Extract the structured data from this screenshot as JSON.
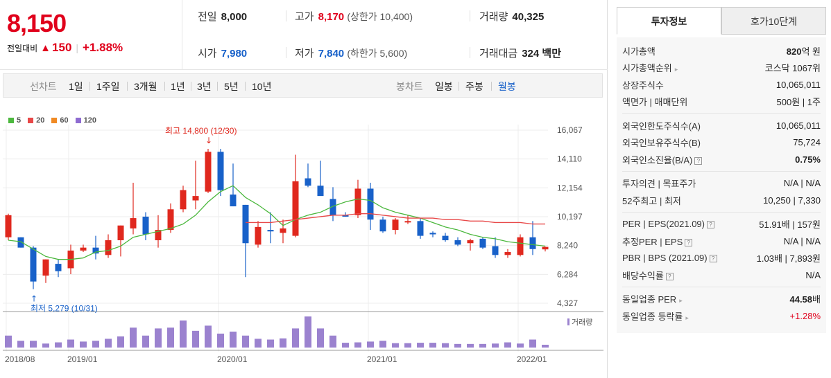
{
  "price": {
    "current": "8,150",
    "change_label": "전일대비",
    "change_amount": "150",
    "change_percent": "+1.88%"
  },
  "summary": {
    "prev_close": {
      "label": "전일",
      "value": "8,000"
    },
    "high": {
      "label": "고가",
      "value": "8,170",
      "sub": "(상한가 10,400)"
    },
    "volume": {
      "label": "거래량",
      "value": "40,325"
    },
    "open": {
      "label": "시가",
      "value": "7,980"
    },
    "low": {
      "label": "저가",
      "value": "7,840",
      "sub": "(하한가 5,600)"
    },
    "amount": {
      "label": "거래대금",
      "value": "324 백만"
    }
  },
  "period_bar": {
    "line_label": "선차트",
    "line_options": [
      "1일",
      "1주일",
      "3개월",
      "1년",
      "3년",
      "5년",
      "10년"
    ],
    "candle_label": "봉차트",
    "candle_options": [
      "일봉",
      "주봉",
      "월봉"
    ],
    "candle_selected": "월봉"
  },
  "chart_data": {
    "type": "candlestick",
    "interval": "monthly",
    "moving_averages": [
      {
        "name": "5",
        "color": "#4cb83e"
      },
      {
        "name": "20",
        "color": "#e84848"
      },
      {
        "name": "60",
        "color": "#f08a24"
      },
      {
        "name": "120",
        "color": "#8e6bd1"
      }
    ],
    "y_ticks": [
      "16,067",
      "14,110",
      "12,154",
      "10,197",
      "8,240",
      "6,284",
      "4,327"
    ],
    "y_range": [
      4327,
      16067
    ],
    "x_ticks": [
      "2018/08",
      "2019/01",
      "2020/01",
      "2021/01",
      "2022/01"
    ],
    "high_annotation": "최고 14,800 (12/30)",
    "low_annotation": "최저 5,279 (10/31)",
    "volume_label": "거래량",
    "candles": [
      {
        "m": "2018/08",
        "o": 8800,
        "h": 10400,
        "l": 8600,
        "c": 10300
      },
      {
        "m": "2018/09",
        "o": 8800,
        "h": 8800,
        "l": 8100,
        "c": 8100
      },
      {
        "m": "2018/10",
        "o": 8100,
        "h": 8200,
        "l": 5279,
        "c": 5800
      },
      {
        "m": "2018/11",
        "o": 6200,
        "h": 7300,
        "l": 5700,
        "c": 7300
      },
      {
        "m": "2018/12",
        "o": 7000,
        "h": 7300,
        "l": 6100,
        "c": 6500
      },
      {
        "m": "2019/01",
        "o": 6700,
        "h": 8300,
        "l": 6300,
        "c": 7900
      },
      {
        "m": "2019/02",
        "o": 7900,
        "h": 8300,
        "l": 7800,
        "c": 8100
      },
      {
        "m": "2019/03",
        "o": 8100,
        "h": 8900,
        "l": 7300,
        "c": 7700
      },
      {
        "m": "2019/04",
        "o": 7600,
        "h": 9000,
        "l": 7400,
        "c": 8600
      },
      {
        "m": "2019/05",
        "o": 8600,
        "h": 9600,
        "l": 7500,
        "c": 9600
      },
      {
        "m": "2019/06",
        "o": 9400,
        "h": 12500,
        "l": 9000,
        "c": 10100
      },
      {
        "m": "2019/07",
        "o": 10200,
        "h": 10500,
        "l": 8600,
        "c": 9000
      },
      {
        "m": "2019/08",
        "o": 8600,
        "h": 10300,
        "l": 8100,
        "c": 9300
      },
      {
        "m": "2019/09",
        "o": 9300,
        "h": 11100,
        "l": 9100,
        "c": 10700
      },
      {
        "m": "2019/10",
        "o": 10700,
        "h": 12300,
        "l": 10500,
        "c": 12000
      },
      {
        "m": "2019/11",
        "o": 11300,
        "h": 14000,
        "l": 10700,
        "c": 11600
      },
      {
        "m": "2019/12",
        "o": 11900,
        "h": 14800,
        "l": 11800,
        "c": 14600
      },
      {
        "m": "2020/01",
        "o": 14600,
        "h": 14800,
        "l": 11600,
        "c": 12000
      },
      {
        "m": "2020/02",
        "o": 11700,
        "h": 13800,
        "l": 10900,
        "c": 10900
      },
      {
        "m": "2020/03",
        "o": 11000,
        "h": 11000,
        "l": 6100,
        "c": 8400
      },
      {
        "m": "2020/04",
        "o": 8300,
        "h": 9900,
        "l": 8100,
        "c": 9500
      },
      {
        "m": "2020/05",
        "o": 9300,
        "h": 10500,
        "l": 8400,
        "c": 9200
      },
      {
        "m": "2020/06",
        "o": 9100,
        "h": 10000,
        "l": 8400,
        "c": 9400
      },
      {
        "m": "2020/07",
        "o": 8900,
        "h": 14400,
        "l": 8800,
        "c": 12600
      },
      {
        "m": "2020/08",
        "o": 12800,
        "h": 13800,
        "l": 12200,
        "c": 12300
      },
      {
        "m": "2020/09",
        "o": 12300,
        "h": 14000,
        "l": 11800,
        "c": 11600
      },
      {
        "m": "2020/10",
        "o": 11400,
        "h": 12200,
        "l": 9900,
        "c": 10300
      },
      {
        "m": "2020/11",
        "o": 10300,
        "h": 10500,
        "l": 10200,
        "c": 10200
      },
      {
        "m": "2020/12",
        "o": 10300,
        "h": 12700,
        "l": 10100,
        "c": 12100
      },
      {
        "m": "2021/01",
        "o": 12100,
        "h": 12500,
        "l": 9300,
        "c": 10000
      },
      {
        "m": "2021/02",
        "o": 10000,
        "h": 10200,
        "l": 9100,
        "c": 9200
      },
      {
        "m": "2021/03",
        "o": 9300,
        "h": 10100,
        "l": 9000,
        "c": 10000
      },
      {
        "m": "2021/04",
        "o": 9900,
        "h": 10300,
        "l": 9700,
        "c": 9900
      },
      {
        "m": "2021/05",
        "o": 9900,
        "h": 10100,
        "l": 8700,
        "c": 8900
      },
      {
        "m": "2021/06",
        "o": 9100,
        "h": 9200,
        "l": 8800,
        "c": 9000
      },
      {
        "m": "2021/07",
        "o": 8900,
        "h": 9100,
        "l": 8500,
        "c": 8600
      },
      {
        "m": "2021/08",
        "o": 8600,
        "h": 8800,
        "l": 8200,
        "c": 8300
      },
      {
        "m": "2021/09",
        "o": 8400,
        "h": 8700,
        "l": 7900,
        "c": 8600
      },
      {
        "m": "2021/10",
        "o": 8700,
        "h": 8800,
        "l": 8000,
        "c": 8100
      },
      {
        "m": "2021/11",
        "o": 8200,
        "h": 8800,
        "l": 7400,
        "c": 7600
      },
      {
        "m": "2021/12",
        "o": 7600,
        "h": 8000,
        "l": 7400,
        "c": 7800
      },
      {
        "m": "2022/01",
        "o": 7600,
        "h": 9000,
        "l": 7500,
        "c": 8800
      },
      {
        "m": "2022/02",
        "o": 8800,
        "h": 9900,
        "l": 7600,
        "c": 8000
      },
      {
        "m": "2022/03",
        "o": 7980,
        "h": 8170,
        "l": 7840,
        "c": 8150
      }
    ],
    "ma5": [
      8600,
      8500,
      8000,
      7500,
      7300,
      7300,
      7400,
      7800,
      7900,
      8200,
      8800,
      9000,
      9200,
      9400,
      9700,
      10300,
      11200,
      11900,
      12300,
      11500,
      11000,
      10400,
      9600,
      10000,
      10300,
      10500,
      10900,
      11200,
      11400,
      11300,
      10800,
      10500,
      10300,
      10100,
      9800,
      9500,
      9300,
      9000,
      8800,
      8700,
      8500,
      8400,
      8300,
      8200
    ],
    "ma20_start": 19,
    "ma20": [
      9800,
      9800,
      9800,
      9900,
      10000,
      10100,
      10200,
      10300,
      10300,
      10400,
      10400,
      10300,
      10200,
      10100,
      10100,
      10100,
      10000,
      10000,
      9900,
      9900,
      9800,
      9800,
      9800,
      9700,
      9700
    ],
    "volumes": [
      30,
      17,
      17,
      10,
      13,
      20,
      15,
      17,
      22,
      28,
      50,
      30,
      48,
      50,
      68,
      42,
      55,
      35,
      40,
      30,
      22,
      20,
      23,
      48,
      78,
      48,
      30,
      12,
      13,
      15,
      17,
      11,
      11,
      12,
      12,
      11,
      9,
      9,
      9,
      10,
      13,
      10,
      20,
      7
    ]
  },
  "side_tabs": [
    "투자정보",
    "호가10단계"
  ],
  "investment_info": {
    "groups": [
      [
        {
          "label": "시가총액",
          "value_bold": "820",
          "value_rest": "억 원"
        },
        {
          "label": "시가총액순위",
          "value": "코스닥 1067위",
          "arrow": "▸"
        },
        {
          "label": "상장주식수",
          "value": "10,065,011"
        },
        {
          "label": "액면가 | 매매단위",
          "value": "500원 | 1주"
        }
      ],
      [
        {
          "label": "외국인한도주식수(A)",
          "value": "10,065,011"
        },
        {
          "label": "외국인보유주식수(B)",
          "value": "75,724"
        },
        {
          "label": "외국인소진율(B/A)",
          "value_bold": "0.75%",
          "help": "?"
        }
      ],
      [
        {
          "label": "투자의견 | 목표주가",
          "value": "N/A | N/A"
        },
        {
          "label": "52주최고 | 최저",
          "value": "10,250 | 7,330"
        }
      ],
      [
        {
          "label": "PER | EPS(2021.09)",
          "value": "51.91배 | 157원",
          "help": "?"
        },
        {
          "label": "추정PER | EPS",
          "value": "N/A | N/A",
          "help": "?"
        },
        {
          "label": "PBR | BPS (2021.09)",
          "value": "1.03배 | 7,893원",
          "help": "?"
        },
        {
          "label": "배당수익률",
          "value": "N/A",
          "help": "?"
        }
      ],
      [
        {
          "label": "동일업종 PER",
          "value_bold": "44.58",
          "value_rest": "배",
          "arrow": "▸"
        },
        {
          "label": "동일업종 등락률",
          "value_red": "+1.28%",
          "arrow": "▸"
        }
      ]
    ]
  }
}
